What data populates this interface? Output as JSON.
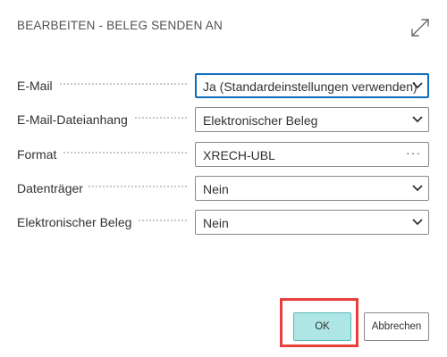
{
  "dialog": {
    "title": "BEARBEITEN - BELEG SENDEN AN"
  },
  "fields": [
    {
      "label": "E-Mail",
      "value": "Ja (Standardeinstellungen verwenden)",
      "control": "select"
    },
    {
      "label": "E-Mail-Dateianhang",
      "value": "Elektronischer Beleg",
      "control": "select"
    },
    {
      "label": "Format",
      "value": "XRECH-UBL",
      "control": "lookup",
      "lookup_glyph": "···"
    },
    {
      "label": "Datenträger",
      "value": "Nein",
      "control": "select"
    },
    {
      "label": "Elektronischer Beleg",
      "value": "Nein",
      "control": "select"
    }
  ],
  "buttons": {
    "ok_label": "OK",
    "cancel_label": "Abbrechen"
  },
  "colors": {
    "ok_bg": "#aee6e6",
    "highlight": "#e8403b",
    "focus": "#0f6cbd"
  },
  "icons": {
    "expand": "expand-diagonal-icon",
    "dropdown": "chevron-down-icon",
    "lookup": "ellipsis-icon"
  }
}
